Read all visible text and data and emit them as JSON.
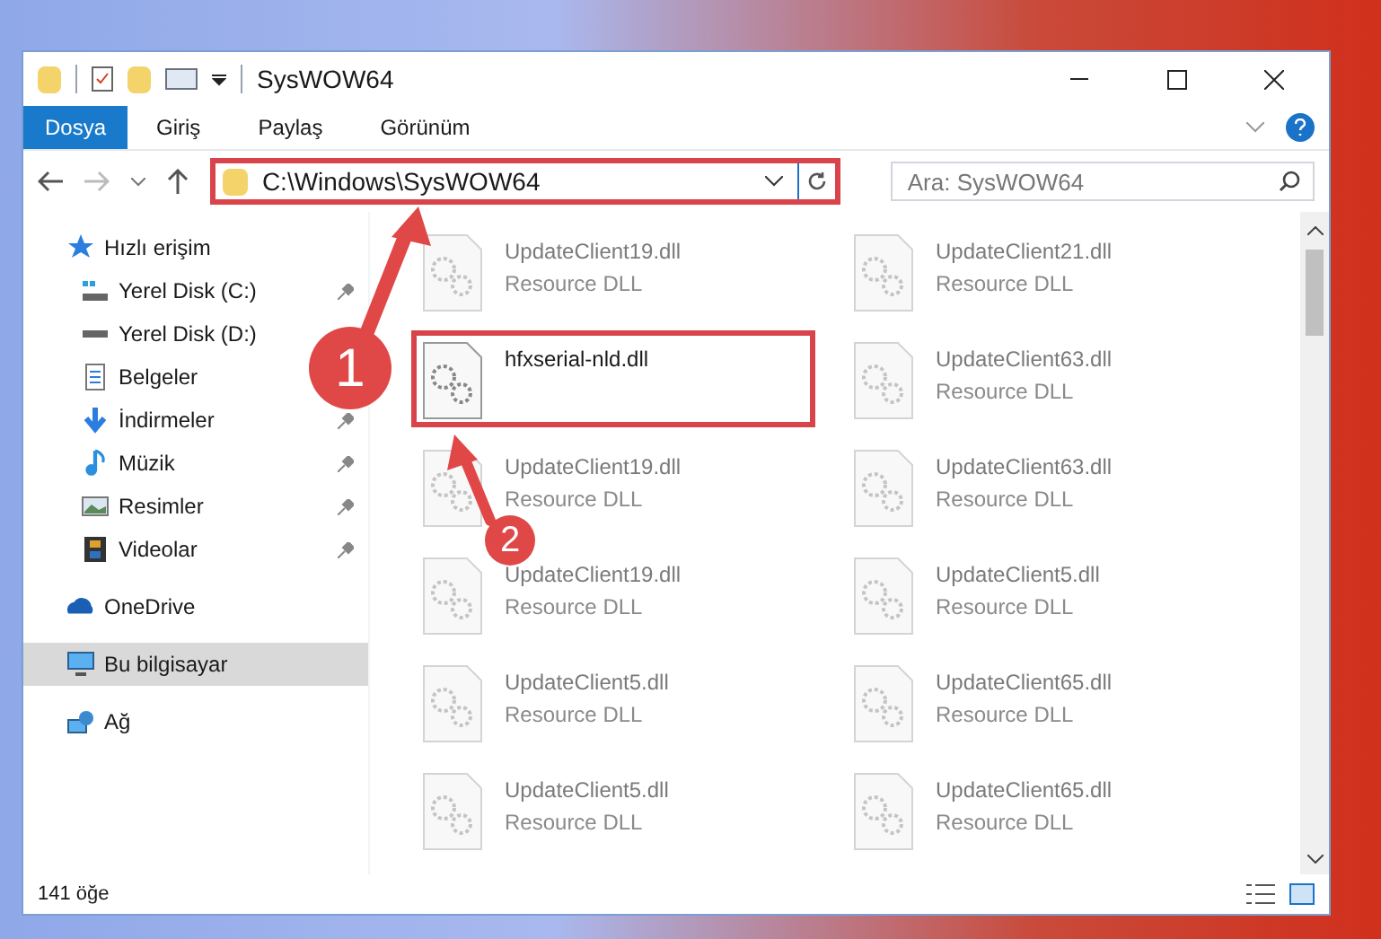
{
  "window": {
    "title": "SysWOW64"
  },
  "ribbon_tabs": [
    {
      "label": "Dosya",
      "selected": true
    },
    {
      "label": "Giriş",
      "selected": false
    },
    {
      "label": "Paylaş",
      "selected": false
    },
    {
      "label": "Görünüm",
      "selected": false
    }
  ],
  "address_bar": {
    "path": "C:\\Windows\\SysWOW64",
    "highlighted": true
  },
  "search": {
    "placeholder": "Ara: SysWOW64"
  },
  "sidebar": {
    "items": [
      {
        "label": "Hızlı erişim",
        "kind": "star",
        "pinned": false,
        "selected": false
      },
      {
        "label": "Yerel Disk (C:)",
        "kind": "drive-c",
        "pinned": true,
        "selected": false
      },
      {
        "label": "Yerel Disk (D:)",
        "kind": "drive",
        "pinned": false,
        "selected": false
      },
      {
        "label": "Belgeler",
        "kind": "doc",
        "pinned": false,
        "selected": false
      },
      {
        "label": "İndirmeler",
        "kind": "download",
        "pinned": true,
        "selected": false
      },
      {
        "label": "Müzik",
        "kind": "music",
        "pinned": true,
        "selected": false
      },
      {
        "label": "Resimler",
        "kind": "pictures",
        "pinned": true,
        "selected": false
      },
      {
        "label": "Videolar",
        "kind": "video",
        "pinned": true,
        "selected": false
      },
      {
        "label": "OneDrive",
        "kind": "cloud",
        "pinned": false,
        "selected": false
      },
      {
        "label": "Bu bilgisayar",
        "kind": "pc",
        "pinned": false,
        "selected": true
      },
      {
        "label": "Ağ",
        "kind": "network",
        "pinned": false,
        "selected": false
      }
    ]
  },
  "files": [
    {
      "name": "UpdateClient19.dll",
      "type": "Resource DLL",
      "faded": true,
      "highlighted": false
    },
    {
      "name": "UpdateClient21.dll",
      "type": "Resource DLL",
      "faded": true,
      "highlighted": false
    },
    {
      "name": "hfxserial-nld.dll",
      "faded": false,
      "highlighted": true
    },
    {
      "name": "UpdateClient63.dll",
      "type": "Resource DLL",
      "faded": true,
      "highlighted": false
    },
    {
      "name": "UpdateClient19.dll",
      "type": "Resource DLL",
      "faded": true,
      "highlighted": false
    },
    {
      "name": "UpdateClient63.dll",
      "type": "Resource DLL",
      "faded": true,
      "highlighted": false
    },
    {
      "name": "UpdateClient19.dll",
      "type": "Resource DLL",
      "faded": true,
      "highlighted": false
    },
    {
      "name": "UpdateClient5.dll",
      "type": "Resource DLL",
      "faded": true,
      "highlighted": false
    },
    {
      "name": "UpdateClient5.dll",
      "type": "Resource DLL",
      "faded": true,
      "highlighted": false
    },
    {
      "name": "UpdateClient65.dll",
      "type": "Resource DLL",
      "faded": true,
      "highlighted": false
    },
    {
      "name": "UpdateClient5.dll",
      "type": "Resource DLL",
      "faded": true,
      "highlighted": false
    },
    {
      "name": "UpdateClient65.dll",
      "type": "Resource DLL",
      "faded": true,
      "highlighted": false
    }
  ],
  "status_bar": {
    "count": "141 öğe"
  },
  "callouts": [
    {
      "label": "1"
    },
    {
      "label": "2"
    }
  ]
}
